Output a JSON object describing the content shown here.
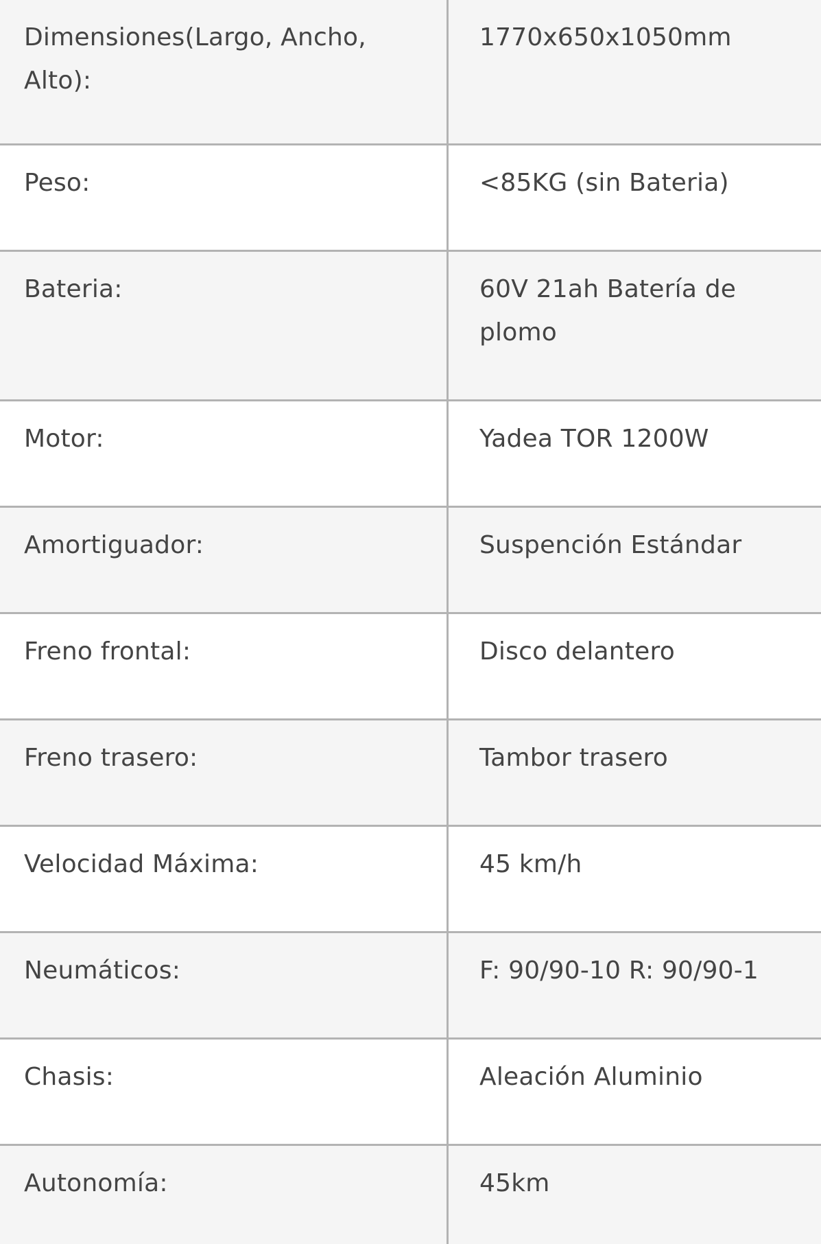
{
  "spec_table": {
    "rows": [
      {
        "label": "Dimensiones(Largo, Ancho, Alto):",
        "value": "1770x650x1050mm"
      },
      {
        "label": "Peso:",
        "value": "<85KG (sin Bateria)"
      },
      {
        "label": "Bateria:",
        "value": "60V 21ah Batería de plomo"
      },
      {
        "label": "Motor:",
        "value": "Yadea TOR 1200W"
      },
      {
        "label": "Amortiguador:",
        "value": "Suspención Estándar"
      },
      {
        "label": "Freno frontal:",
        "value": "Disco delantero"
      },
      {
        "label": "Freno trasero:",
        "value": "Tambor trasero"
      },
      {
        "label": "Velocidad Máxima:",
        "value": "45 km/h"
      },
      {
        "label": "Neumáticos:",
        "value": "F: 90/90-10 R: 90/90-1"
      },
      {
        "label": "Chasis:",
        "value": "Aleación Aluminio"
      },
      {
        "label": "Autonomía:",
        "value": "45km"
      }
    ]
  }
}
